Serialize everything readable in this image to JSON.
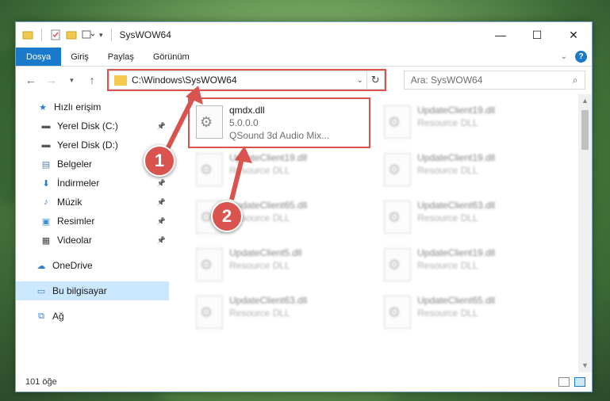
{
  "window": {
    "title": "SysWOW64",
    "minimize_glyph": "—",
    "maximize_glyph": "☐",
    "close_glyph": "✕"
  },
  "ribbon": {
    "tabs": [
      {
        "label": "Dosya",
        "active": true
      },
      {
        "label": "Giriş"
      },
      {
        "label": "Paylaş"
      },
      {
        "label": "Görünüm"
      }
    ],
    "help_glyph": "?"
  },
  "navigation": {
    "address": "C:\\Windows\\SysWOW64",
    "search_placeholder": "Ara: SysWOW64"
  },
  "sidebar": {
    "items": [
      {
        "label": "Hızlı erişim",
        "icon": "star-icon"
      },
      {
        "label": "Yerel Disk (C:)",
        "icon": "drive-icon",
        "pinned": true
      },
      {
        "label": "Yerel Disk (D:)",
        "icon": "drive-icon"
      },
      {
        "label": "Belgeler",
        "icon": "documents-icon"
      },
      {
        "label": "İndirmeler",
        "icon": "download-icon",
        "pinned": true
      },
      {
        "label": "Müzik",
        "icon": "music-icon",
        "pinned": true
      },
      {
        "label": "Resimler",
        "icon": "pictures-icon",
        "pinned": true
      },
      {
        "label": "Videolar",
        "icon": "videos-icon",
        "pinned": true
      },
      {
        "label": "OneDrive",
        "icon": "cloud-icon"
      },
      {
        "label": "Bu bilgisayar",
        "icon": "computer-icon",
        "selected": true
      },
      {
        "label": "Ağ",
        "icon": "network-icon"
      }
    ]
  },
  "files": [
    {
      "name": "qmdx.dll",
      "line2": "5.0.0.0",
      "line3": "QSound 3d Audio Mix...",
      "highlighted": true
    },
    {
      "name": "UpdateClient19.dll",
      "line2": "Resource DLL"
    },
    {
      "name": "UpdateClient19.dll",
      "line2": "Resource DLL"
    },
    {
      "name": "UpdateClient19.dll",
      "line2": "Resource DLL"
    },
    {
      "name": "UpdateClient65.dll",
      "line2": "Resource DLL"
    },
    {
      "name": "UpdateClient63.dll",
      "line2": "Resource DLL"
    },
    {
      "name": "UpdateClient5.dll",
      "line2": "Resource DLL"
    },
    {
      "name": "UpdateClient19.dll",
      "line2": "Resource DLL"
    },
    {
      "name": "UpdateClient63.dll",
      "line2": "Resource DLL"
    },
    {
      "name": "UpdateClient65.dll",
      "line2": "Resource DLL"
    }
  ],
  "status": {
    "item_count": "101 öğe"
  },
  "annotations": {
    "marker1": "1",
    "marker2": "2",
    "color": "#d9534f"
  }
}
